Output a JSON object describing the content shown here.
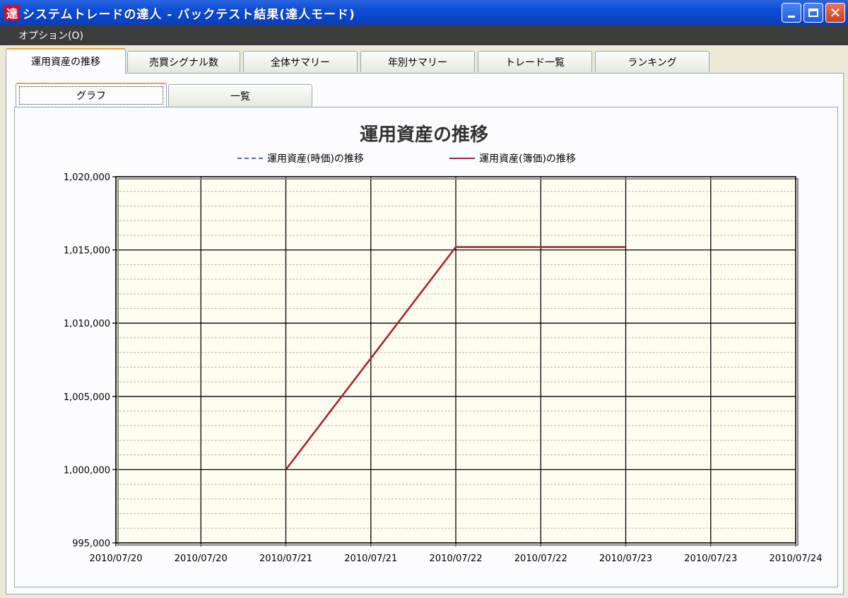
{
  "window": {
    "icon_char": "達",
    "title": "システムトレードの達人 - バックテスト結果(達人モード)"
  },
  "menu": {
    "items": [
      "オプション(O)"
    ]
  },
  "tabs": [
    "運用資産の推移",
    "売買シグナル数",
    "全体サマリー",
    "年別サマリー",
    "トレード一覧",
    "ランキング"
  ],
  "active_tab": 0,
  "subtabs": [
    "グラフ",
    "一覧"
  ],
  "active_subtab": 0,
  "colors": {
    "line_book": "#a81e2a",
    "line_market": "#4a6fb0",
    "plot_bg": "#fffdf0"
  },
  "chart_data": {
    "type": "line",
    "title": "運用資産の推移",
    "ylim": [
      995000,
      1020000
    ],
    "y_ticks": [
      "995,000",
      "1,000,000",
      "1,005,000",
      "1,010,000",
      "1,015,000",
      "1,020,000"
    ],
    "x_ticks": [
      "2010/07/20",
      "2010/07/20",
      "2010/07/21",
      "2010/07/21",
      "2010/07/22",
      "2010/07/22",
      "2010/07/23",
      "2010/07/23",
      "2010/07/24"
    ],
    "x_index_range": [
      0,
      8
    ],
    "grid": true,
    "legend_position": "top",
    "series": [
      {
        "name": "運用資産(時価)の推移",
        "style": "dash-dot",
        "color": "#4a6fb0",
        "points": []
      },
      {
        "name": "運用資産(簿価)の推移",
        "style": "solid",
        "color": "#a81e2a",
        "points": [
          [
            2,
            1000000
          ],
          [
            4,
            1015200
          ],
          [
            6,
            1015200
          ]
        ]
      }
    ]
  }
}
